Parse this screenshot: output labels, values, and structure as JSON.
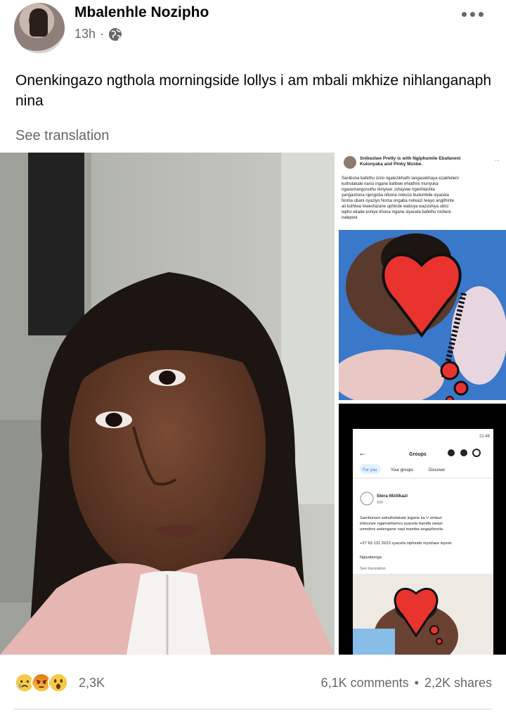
{
  "post": {
    "author": "Mbalenhle Nozipho",
    "time": "13h",
    "separator": "·",
    "text": "Onenkingazo ngthola morningside lollys i am mbali mkhize nihlanganaph nina",
    "see_translation": "See translation"
  },
  "embedded_post_1": {
    "author_line": "Snikeziwe Pretty is with Ngiphumile Ebafaneni Kulonyaka and Pinky Mzobe.",
    "body": "Sanibona bafethu izolo ngalezikhathi langasekhaya ezakheleni kutholakale nansi ingane ilahliwe ehlathini munyuka ngasemangosuthu ❤ ikinyiwe ,ishayiwe ngenhlanhla yangashona njengoba nibona nobuso budumbile ❤ siyacela Noma ubani oyaziyo Noma ongaba nolwazi lwayo angithinte aii kuthiwa lowesfazane uphinde wabuya wazoshiya ubisi lapho ekade eshiye khona ingane siyacela bafethu nishere nalepost"
  },
  "embedded_post_2": {
    "status_time": "21:46",
    "screen_title": "Groups",
    "tabs": [
      "For you",
      "Your groups",
      "Discover"
    ],
    "author": "Slera Mzilikazi",
    "time": "10h",
    "body": "Sanibonani sekutholakale ingane ka V emlazi imbozwe ngamahlamvu syacela bandla owazi umndeni walengane nayi inamba angayfonela",
    "phone_line": "+27 63 131 2623 syacela niphinde niyishare lepost",
    "thanks": "Ngiyabonga",
    "see_translation": "See translation"
  },
  "footer": {
    "reactions": [
      "sad",
      "angry",
      "wow"
    ],
    "reaction_count": "2,3K",
    "comments": "6,1K comments",
    "bullet": "•",
    "shares": "2,2K shares"
  },
  "icons": {
    "more": "more-horizontal-icon",
    "privacy": "globe-icon"
  },
  "colors": {
    "secondary_text": "#65676b",
    "heart_red": "#e8332f",
    "fb_blue": "#1877f2"
  }
}
